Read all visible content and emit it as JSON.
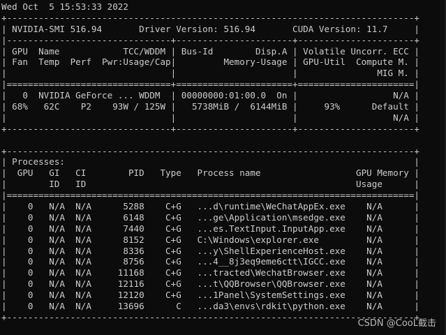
{
  "terminal": {
    "lines": [
      "Wed Oct  5 15:53:33 2022",
      "+-----------------------------------------------------------------------------+",
      "| NVIDIA-SMI 516.94       Driver Version: 516.94       CUDA Version: 11.7     |",
      "|-------------------------------+----------------------+----------------------+",
      "| GPU  Name            TCC/WDDM | Bus-Id        Disp.A | Volatile Uncorr. ECC |",
      "| Fan  Temp  Perf  Pwr:Usage/Cap|         Memory-Usage | GPU-Util  Compute M. |",
      "|                               |                      |               MIG M. |",
      "|===============================+======================+======================|",
      "|   0  NVIDIA GeForce ... WDDM  | 00000000:01:00.0  On |                  N/A |",
      "| 68%   62C    P2    93W / 125W |   5738MiB /  6144MiB |     93%      Default |",
      "|                               |                      |                  N/A |",
      "+-------------------------------+----------------------+----------------------+",
      "",
      "+-----------------------------------------------------------------------------+",
      "| Processes:                                                                  |",
      "|  GPU   GI   CI        PID   Type   Process name                  GPU Memory |",
      "|        ID   ID                                                   Usage      |",
      "|=============================================================================|",
      "|    0   N/A  N/A      5288    C+G   ...d\\runtime\\WeChatAppEx.exe    N/A      |",
      "|    0   N/A  N/A      6148    C+G   ...ge\\Application\\msedge.exe    N/A      |",
      "|    0   N/A  N/A      7440    C+G   ...es.TextInput.InputApp.exe    N/A      |",
      "|    0   N/A  N/A      8152    C+G   C:\\Windows\\explorer.exe         N/A      |",
      "|    0   N/A  N/A      8336    C+G   ...y\\ShellExperienceHost.exe    N/A      |",
      "|    0   N/A  N/A      8756    C+G   ...4__8j3eq9eme6ctt\\IGCC.exe    N/A      |",
      "|    0   N/A  N/A     11168    C+G   ...tracted\\WechatBrowser.exe    N/A      |",
      "|    0   N/A  N/A     12116    C+G   ...t\\QQBrowser\\QQBrowser.exe    N/A      |",
      "|    0   N/A  N/A     12120    C+G   ...1Panel\\SystemSettings.exe    N/A      |",
      "|    0   N/A  N/A     13696      C   ...da3\\envs\\rdkit\\python.exe    N/A      |",
      "+-----------------------------------------------------------------------------+"
    ]
  },
  "watermark": {
    "text": "CSDN @CooL截击"
  }
}
